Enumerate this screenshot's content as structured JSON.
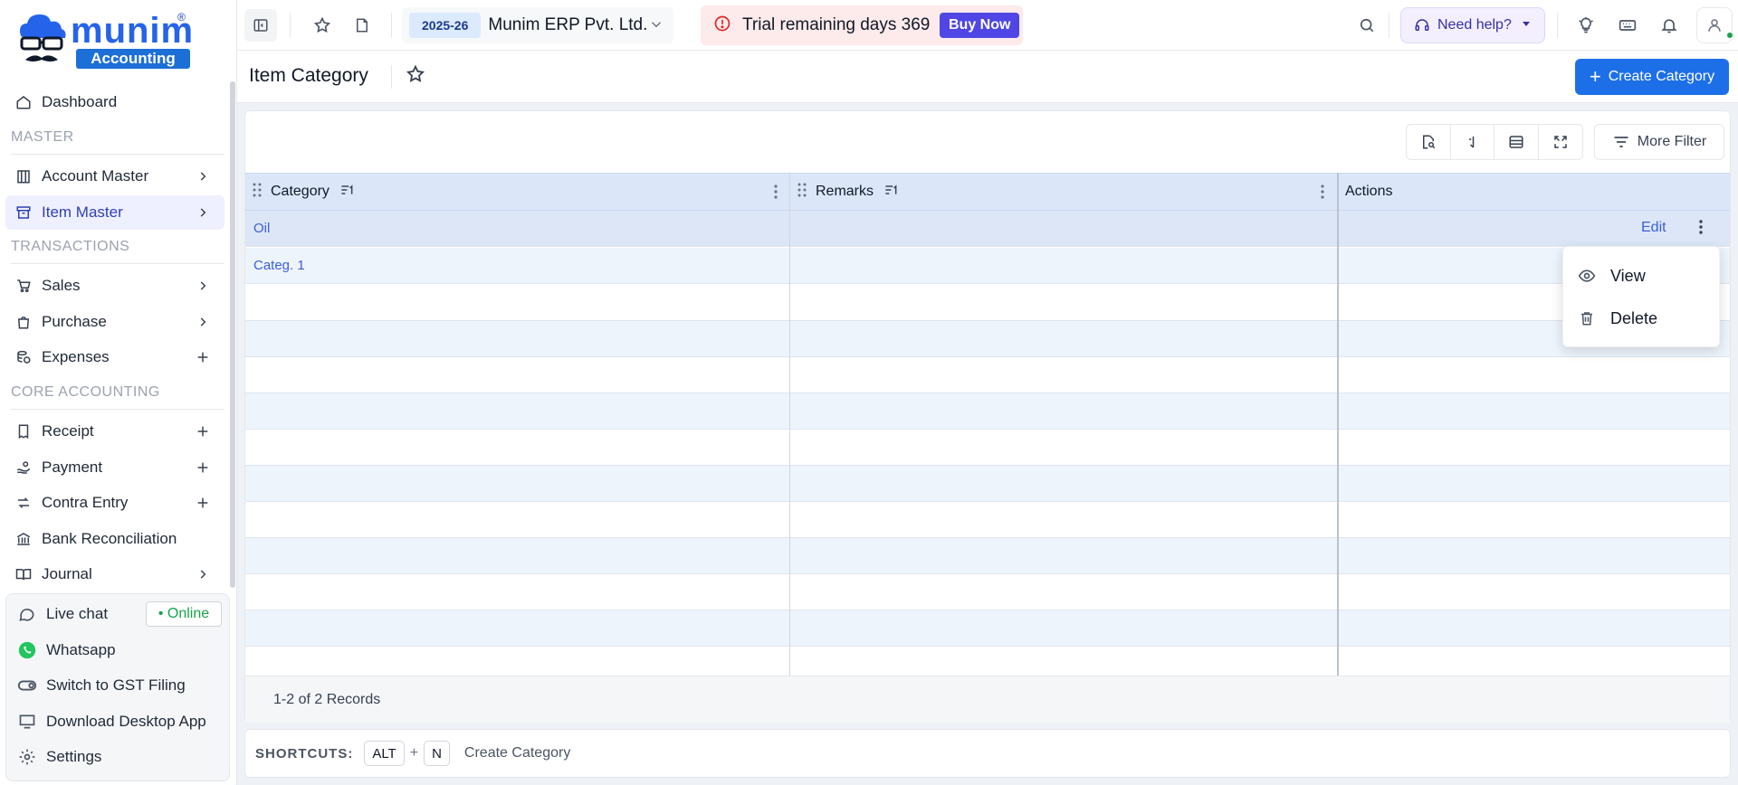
{
  "brand": {
    "name": "munim",
    "tag": "Accounting",
    "reg": "®"
  },
  "sidebar": {
    "dashboard": "Dashboard",
    "sections": {
      "master": "MASTER",
      "transactions": "TRANSACTIONS",
      "core": "CORE ACCOUNTING"
    },
    "items": {
      "account_master": "Account Master",
      "item_master": "Item Master",
      "sales": "Sales",
      "purchase": "Purchase",
      "expenses": "Expenses",
      "receipt": "Receipt",
      "payment": "Payment",
      "contra": "Contra Entry",
      "bank_rec": "Bank Reconciliation",
      "journal": "Journal"
    },
    "bottom": {
      "live_chat": "Live chat",
      "online": "• Online",
      "whatsapp": "Whatsapp",
      "gst": "Switch to GST Filing",
      "download": "Download Desktop App",
      "settings": "Settings"
    }
  },
  "topbar": {
    "year": "2025-26",
    "company": "Munim ERP Pvt. Ltd.",
    "trial": "Trial remaining days 369",
    "buy_now": "Buy Now",
    "help": "Need help?"
  },
  "header": {
    "title": "Item Category",
    "create_label": "Create Category"
  },
  "toolbar": {
    "more_filter": "More Filter"
  },
  "table": {
    "columns": [
      "Category",
      "Remarks",
      "Actions"
    ],
    "rows": [
      {
        "category": "Oil",
        "remarks": "",
        "action": "Edit"
      },
      {
        "category": "Categ. 1",
        "remarks": "",
        "action": ""
      }
    ],
    "records": "1-2 of 2 Records"
  },
  "context_menu": {
    "view": "View",
    "delete": "Delete"
  },
  "shortcuts": {
    "label": "SHORTCUTS:",
    "key1": "ALT",
    "plus": "+",
    "key2": "N",
    "action": "Create Category"
  },
  "colors": {
    "primary": "#1d6fe8",
    "accent": "#4f46e5",
    "online": "#16a34a",
    "header_bg": "#dbe7f8"
  }
}
